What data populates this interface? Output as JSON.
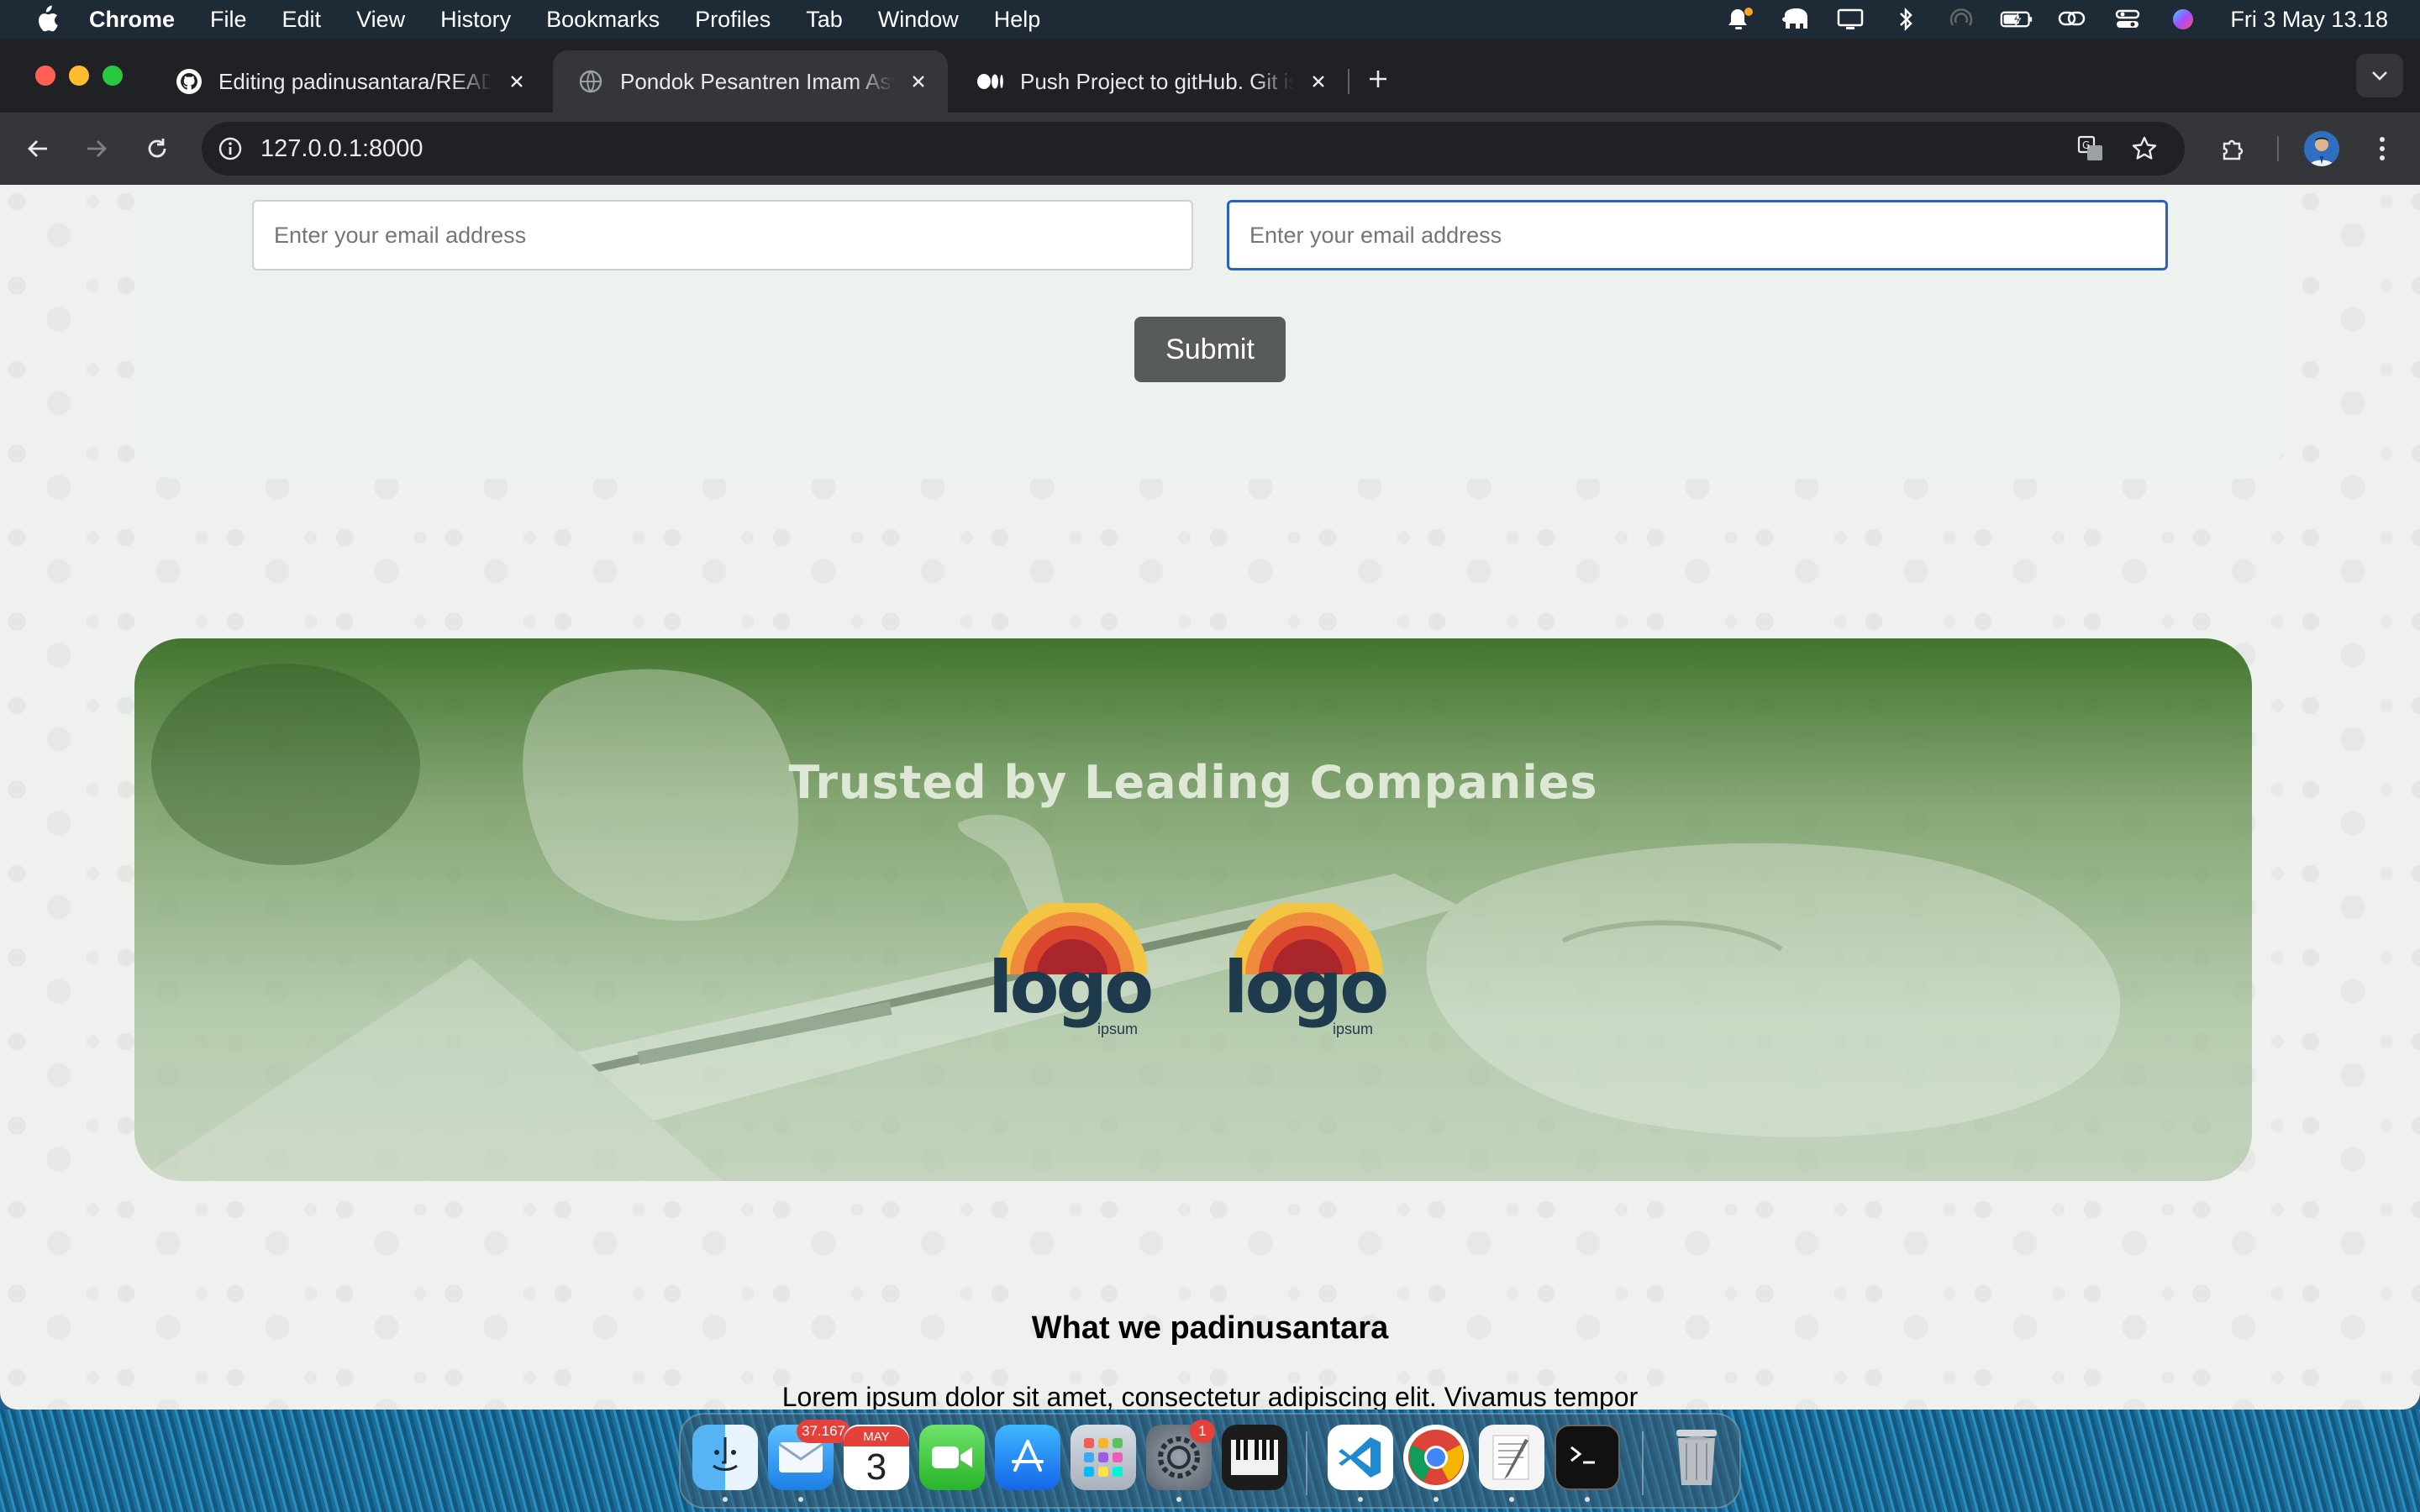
{
  "menubar": {
    "app_name": "Chrome",
    "items": [
      "File",
      "Edit",
      "View",
      "History",
      "Bookmarks",
      "Profiles",
      "Tab",
      "Window",
      "Help"
    ],
    "clock": "Fri 3 May  13.18"
  },
  "tabs": [
    {
      "title": "Editing padinusantara/README.md",
      "icon": "github-icon",
      "active": false
    },
    {
      "title": "Pondok Pesantren Imam Asy-Syafi'i",
      "icon": "globe-icon",
      "active": true
    },
    {
      "title": "Push Project to gitHub. Git is a",
      "icon": "medium-icon",
      "active": false
    }
  ],
  "toolbar": {
    "url": "127.0.0.1:8000"
  },
  "form": {
    "email_placeholder_left": "Enter your email address",
    "email_placeholder_right": "Enter your email address",
    "submit_label": "Submit"
  },
  "trusted": {
    "heading": "Trusted by Leading Companies",
    "logos": [
      {
        "text": "logo",
        "sub": "ipsum"
      },
      {
        "text": "logo",
        "sub": "ipsum"
      }
    ]
  },
  "what": {
    "title": "What we padinusantara",
    "text": "Lorem ipsum dolor sit amet, consectetur adipiscing elit. Vivamus tempor"
  },
  "dock": {
    "mail_badge": "37.167",
    "calendar_month": "MAY",
    "calendar_day": "3",
    "settings_badge": "1",
    "apps": [
      "finder-icon",
      "mail-icon",
      "calendar-icon",
      "facetime-icon",
      "app-store-icon",
      "launchpad-icon",
      "system-settings-icon",
      "piano-icon",
      "vscode-icon",
      "chrome-icon",
      "textedit-icon",
      "terminal-icon",
      "trash-icon"
    ]
  },
  "colors": {
    "accent_focus": "#2c5fc6",
    "submit_bg": "#575b59",
    "trusted_green": "#3a6e24"
  }
}
